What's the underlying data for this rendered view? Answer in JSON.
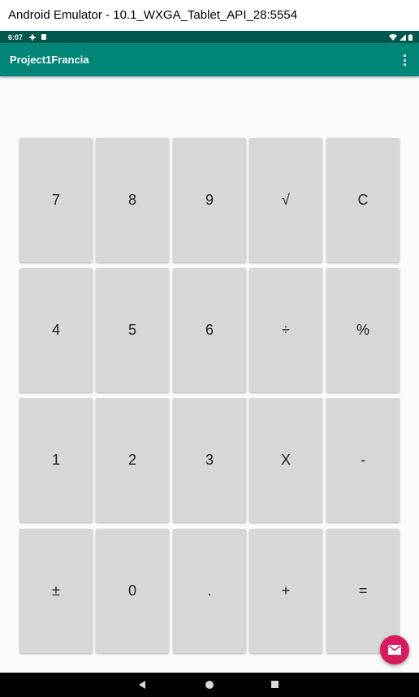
{
  "window": {
    "title": "Android Emulator - 10.1_WXGA_Tablet_API_28:5554"
  },
  "statusbar": {
    "time": "6:07",
    "icons_left": [
      "gear-icon",
      "sd-card-icon"
    ],
    "icons_right": [
      "wifi-icon",
      "cell-signal-icon",
      "battery-icon"
    ]
  },
  "appbar": {
    "title": "Project1Francia",
    "menu_icon": "more-vert-icon"
  },
  "colors": {
    "statusbar": "#00574b",
    "appbar": "#008577",
    "key_background": "#d6d7d7",
    "fab": "#d81b60",
    "screen_background": "#fafafa"
  },
  "keypad": {
    "rows": [
      [
        "7",
        "8",
        "9",
        "√",
        "C"
      ],
      [
        "4",
        "5",
        "6",
        "÷",
        "%"
      ],
      [
        "1",
        "2",
        "3",
        "X",
        "-"
      ],
      [
        "±",
        "0",
        ".",
        "+",
        "="
      ]
    ]
  },
  "fab": {
    "icon": "email-icon"
  },
  "navbar": {
    "icons": [
      "back-icon",
      "home-icon",
      "recents-icon"
    ]
  }
}
